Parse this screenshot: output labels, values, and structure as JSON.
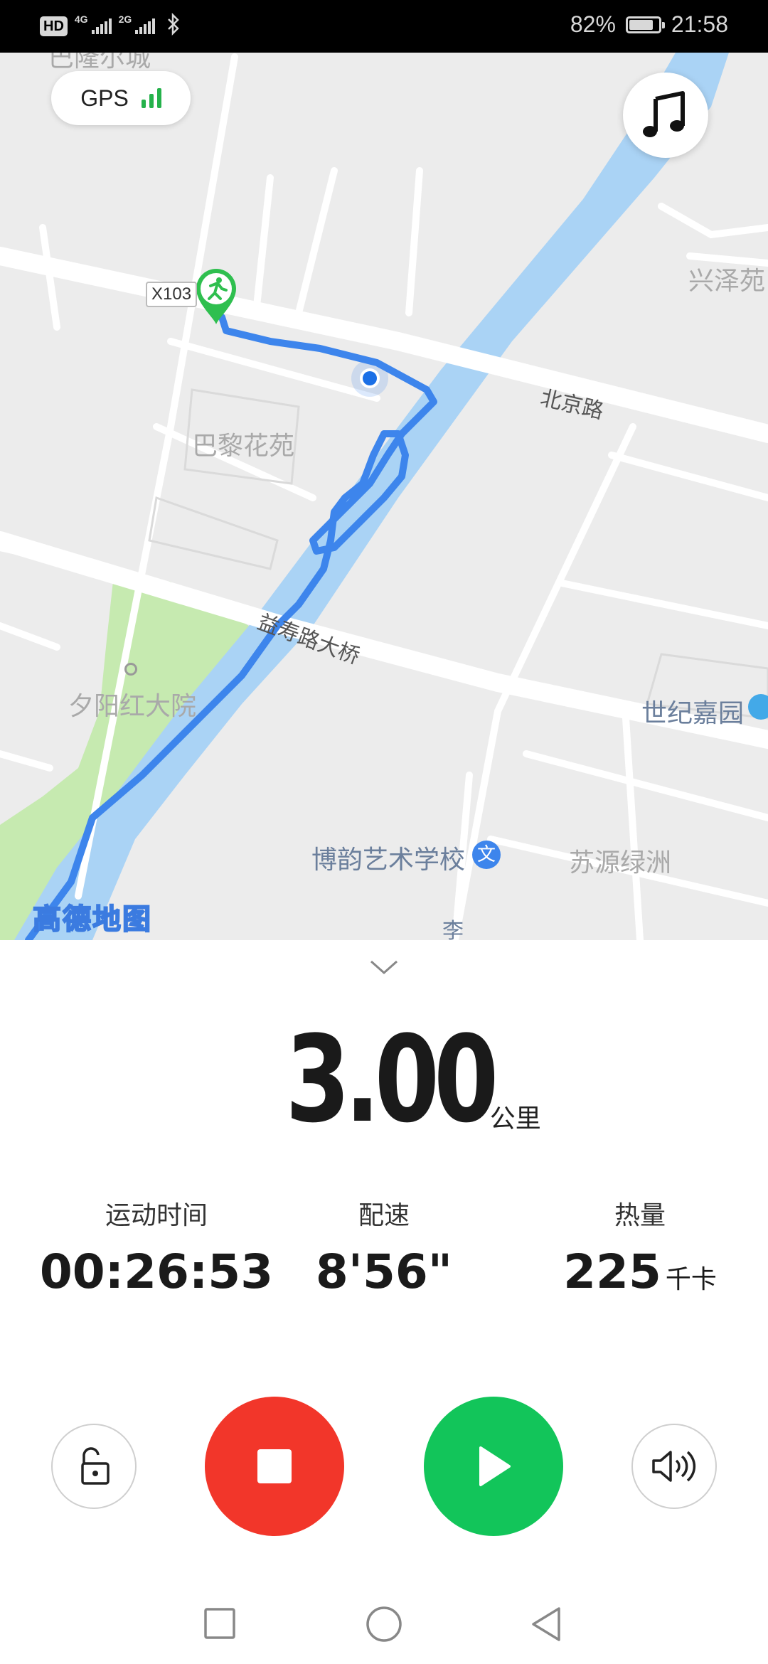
{
  "status_bar": {
    "hd": "HD",
    "sim1": "4G",
    "sim2": "2G",
    "battery_percent": "82%",
    "battery_level": 0.82,
    "time": "21:58",
    "icons": [
      "hd-icon",
      "signal-icon",
      "signal-icon",
      "bluetooth-icon",
      "battery-icon"
    ]
  },
  "map": {
    "labels": {
      "top_cut": "巴隆尔城",
      "xingze": "兴泽苑",
      "bali": "巴黎花苑",
      "xiyang": "夕阳红大院",
      "shiji": "世纪嘉园",
      "boyun": "博韵艺术学校",
      "suyuan": "苏源绿洲",
      "li": "李"
    },
    "roads": {
      "beijing": "北京路",
      "yishou": "益寿路大桥",
      "x103": "X103"
    },
    "logo": "高德地图",
    "colors": {
      "route": "#3d85ec",
      "river": "#aad3f5",
      "park": "#c6eab0",
      "start": "#2fbf4f"
    }
  },
  "gps": {
    "label": "GPS",
    "signal_level": 3,
    "signal_max": 3
  },
  "workout": {
    "distance_value": "3.00",
    "distance_unit": "公里",
    "stats": [
      {
        "label": "运动时间",
        "value": "00:26:53",
        "unit": ""
      },
      {
        "label": "配速",
        "value": "8'56\"",
        "unit": ""
      },
      {
        "label": "热量",
        "value": "225",
        "unit": "千卡"
      }
    ]
  },
  "controls": [
    "lock-icon",
    "stop-icon",
    "play-icon",
    "volume-icon"
  ],
  "colors": {
    "stop": "#f2362a",
    "play": "#12c55a"
  }
}
